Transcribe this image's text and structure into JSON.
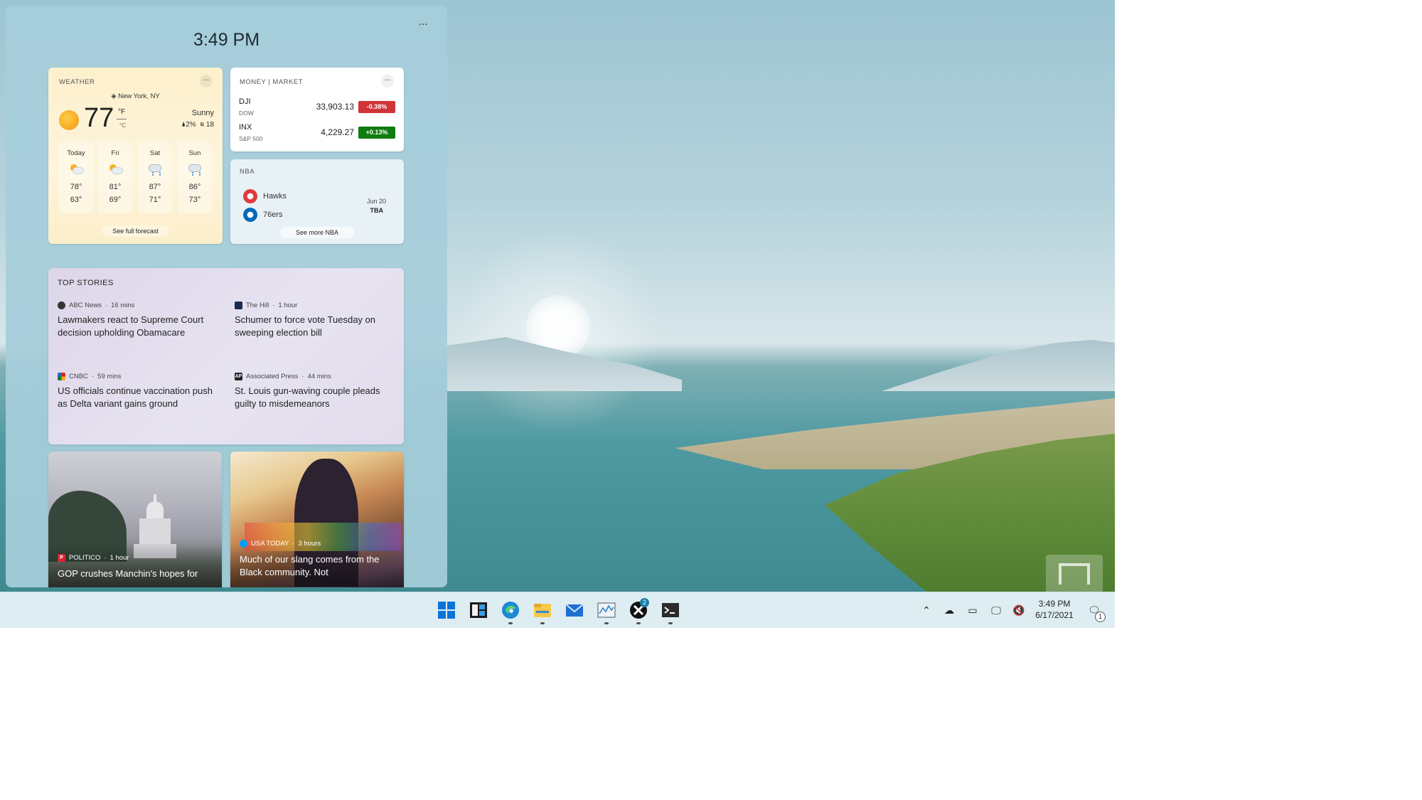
{
  "panel": {
    "time": "3:49 PM",
    "more_label": "..."
  },
  "weather": {
    "title": "WEATHER",
    "more_label": "...",
    "location": "New York, NY",
    "temp": "77",
    "unit_f": "°F",
    "unit_c": "°C",
    "condition": "Sunny",
    "precip": "2%",
    "wind": "18",
    "forecast": [
      {
        "day": "Today",
        "icon": "partly-cloudy-icon",
        "hi": "78°",
        "lo": "63°"
      },
      {
        "day": "Fri",
        "icon": "partly-cloudy-icon",
        "hi": "81°",
        "lo": "69°"
      },
      {
        "day": "Sat",
        "icon": "rain-cloud-icon",
        "hi": "87°",
        "lo": "71°"
      },
      {
        "day": "Sun",
        "icon": "rain-cloud-icon",
        "hi": "86°",
        "lo": "73°"
      }
    ],
    "link": "See full forecast"
  },
  "money": {
    "title": "MONEY | MARKET",
    "more_label": "...",
    "stocks": [
      {
        "symbol": "DJI",
        "index": "DOW",
        "value": "33,903.13",
        "change": "-0.38%",
        "color": "#d13438"
      },
      {
        "symbol": "INX",
        "index": "S&P 500",
        "value": "4,229.27",
        "change": "+0.13%",
        "color": "#107c10"
      }
    ]
  },
  "nba": {
    "title": "NBA",
    "teams": [
      {
        "name": "Hawks",
        "color": "#e03a3e"
      },
      {
        "name": "76ers",
        "color": "#006bb6"
      }
    ],
    "date": "Jun 20",
    "time": "TBA",
    "link": "See more NBA"
  },
  "top_stories": {
    "title": "TOP STORIES",
    "items": [
      {
        "source": "ABC News",
        "age": "16 mins",
        "icon_text": "",
        "title": "Lawmakers react to Supreme Court decision upholding Obamacare"
      },
      {
        "source": "The Hill",
        "age": "1 hour",
        "icon_text": "",
        "title": "Schumer to force vote Tuesday on sweeping election bill"
      },
      {
        "source": "CNBC",
        "age": "59 mins",
        "icon_text": "",
        "title": "US officials continue vaccination push as Delta variant gains ground"
      },
      {
        "source": "Associated Press",
        "age": "44 mins",
        "icon_text": "AP",
        "title": "St. Louis gun-waving couple pleads guilty to misdemeanors"
      }
    ]
  },
  "image_stories": [
    {
      "source": "POLITICO",
      "age": "1 hour",
      "icon_text": "P",
      "title": "GOP crushes Manchin's hopes for"
    },
    {
      "source": "USA TODAY",
      "age": "3 hours",
      "icon_text": "",
      "title": "Much of our slang comes from the Black community. Not"
    }
  ],
  "taskbar": {
    "clock_time": "3:49 PM",
    "clock_date": "6/17/2021",
    "xbox_badge": "2",
    "notification_badge": "1"
  }
}
